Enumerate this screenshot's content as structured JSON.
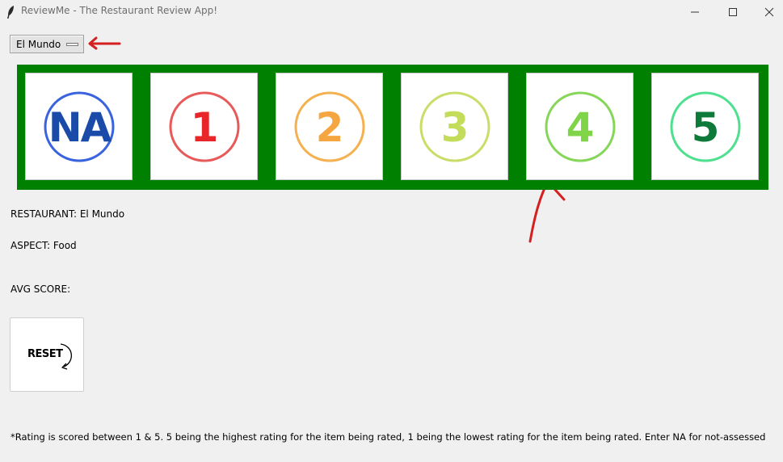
{
  "window": {
    "title": "ReviewMe - The Restaurant Review App!",
    "icon": "feather-icon"
  },
  "dropdown": {
    "selected": "El Mundo"
  },
  "ratings": [
    {
      "label": "NA",
      "color": "#1a4ba8",
      "ring": "#3a63e0"
    },
    {
      "label": "1",
      "color": "#e8262a",
      "ring": "#e85a5a"
    },
    {
      "label": "2",
      "color": "#f5a640",
      "ring": "#f5b04f"
    },
    {
      "label": "3",
      "color": "#c3dd5a",
      "ring": "#c8de68"
    },
    {
      "label": "4",
      "color": "#7fd448",
      "ring": "#86d659"
    },
    {
      "label": "5",
      "color": "#0d7a3a",
      "ring": "#4fe08f"
    }
  ],
  "info": {
    "restaurant": "RESTAURANT: El Mundo",
    "aspect": "ASPECT: Food",
    "avg_score": "AVG SCORE:"
  },
  "reset": {
    "label": "RESET"
  },
  "footnote": "*Rating is scored between 1 & 5. 5 being the highest rating for the item being rated, 1 being the lowest rating for the item being rated. Enter NA for not-assessed",
  "colors": {
    "panel_bg": "#008000",
    "annotation": "#d42020"
  }
}
